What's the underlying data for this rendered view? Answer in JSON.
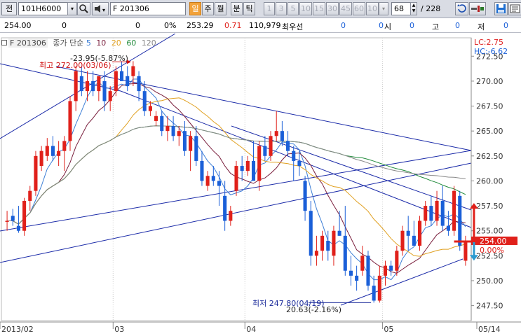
{
  "toolbar": {
    "code_prefix": "전",
    "code": "101H6000",
    "name": "F 201306",
    "periods": [
      "일",
      "주",
      "월",
      "분",
      "틱"
    ],
    "numbers": [
      "1",
      "3",
      "5",
      "10",
      "15",
      "30",
      "45",
      "60",
      "10"
    ],
    "count": "68",
    "total": "/ 228"
  },
  "quote": {
    "price": "254.00",
    "q1": "0",
    "q2": "0",
    "pct": "0%",
    "last": "253.29",
    "chg": "0.71",
    "volume": "110,979",
    "best_label": "최우선",
    "best_val": "0",
    "open_label": "시",
    "open_val": "0",
    "high_label": "고",
    "high_val": "0",
    "low_label": "저",
    "low_val": "0"
  },
  "legend": {
    "name": "F 201306",
    "prefix": "종가 단순",
    "ma": [
      "5",
      "10",
      "20",
      "60",
      "120"
    ]
  },
  "colors": {
    "up": "#e0201a",
    "down": "#1a5fd8",
    "ma5": "#3d7fd6",
    "ma10": "#7a1f3d",
    "ma20": "#e0a020",
    "ma60": "#1f8a3a",
    "ma120": "#888888",
    "trend": "#1a2aa8"
  },
  "annotations": {
    "high_label": "최고 272.00(03/06)",
    "high_pct": "-23.95(-5.87%)",
    "low_label": "최저 247.80(04/19)",
    "low_pct": "20.63(-2.16%)",
    "lc": "LC:2.75",
    "hc": "HC:-6.62",
    "current_price": "254.00",
    "current_pct": "0.00%"
  },
  "chart_data": {
    "type": "candlestick",
    "y_axis": [
      "272.50",
      "270.00",
      "267.50",
      "265.00",
      "262.50",
      "260.00",
      "257.50",
      "255.00",
      "252.50",
      "250.00",
      "247.50"
    ],
    "x_axis": [
      "2013/02",
      "03",
      "04",
      "05",
      "05/14"
    ],
    "ylim": [
      246.0,
      273.5
    ],
    "candles": [
      [
        256.0,
        257.0,
        255.0,
        256.0
      ],
      [
        256.5,
        257.2,
        255.5,
        256.0
      ],
      [
        255.5,
        257.5,
        254.8,
        255.0
      ],
      [
        255.0,
        258.3,
        254.5,
        258.0
      ],
      [
        258.0,
        259.5,
        257.0,
        259.0
      ],
      [
        259.0,
        263.0,
        258.5,
        262.5
      ],
      [
        261.5,
        263.5,
        261.0,
        263.0
      ],
      [
        262.5,
        264.3,
        262.0,
        263.5
      ],
      [
        263.5,
        264.5,
        262.0,
        262.5
      ],
      [
        262.5,
        264.0,
        261.5,
        263.0
      ],
      [
        263.0,
        264.5,
        261.0,
        264.0
      ],
      [
        264.0,
        268.5,
        263.0,
        268.0
      ],
      [
        268.0,
        271.5,
        267.0,
        271.0
      ],
      [
        270.5,
        271.5,
        268.5,
        269.0
      ],
      [
        269.0,
        271.0,
        268.0,
        270.0
      ],
      [
        270.0,
        271.0,
        268.5,
        269.0
      ],
      [
        269.0,
        270.5,
        268.0,
        270.5
      ],
      [
        270.0,
        271.0,
        267.0,
        268.0
      ],
      [
        268.0,
        269.5,
        267.0,
        269.0
      ],
      [
        269.0,
        271.5,
        268.5,
        271.0
      ],
      [
        271.0,
        272.0,
        270.0,
        270.0
      ],
      [
        270.5,
        271.5,
        269.0,
        269.5
      ],
      [
        270.5,
        272.0,
        269.5,
        271.5
      ],
      [
        270.5,
        271.0,
        268.0,
        269.0
      ],
      [
        269.0,
        270.0,
        266.5,
        267.0
      ],
      [
        267.0,
        268.0,
        266.5,
        267.5
      ],
      [
        266.0,
        267.0,
        265.5,
        266.5
      ],
      [
        266.5,
        267.0,
        264.5,
        265.0
      ],
      [
        265.0,
        266.5,
        264.0,
        265.5
      ],
      [
        265.5,
        266.5,
        264.0,
        264.5
      ],
      [
        264.5,
        265.5,
        263.5,
        265.0
      ],
      [
        265.0,
        266.0,
        262.5,
        263.0
      ],
      [
        263.0,
        265.0,
        261.0,
        264.5
      ],
      [
        264.5,
        265.5,
        261.5,
        262.0
      ],
      [
        262.0,
        263.0,
        259.5,
        260.0
      ],
      [
        259.5,
        261.0,
        259.0,
        260.5
      ],
      [
        260.5,
        261.5,
        259.5,
        260.0
      ],
      [
        260.0,
        261.0,
        257.5,
        259.5
      ],
      [
        258.5,
        260.0,
        255.0,
        256.0
      ],
      [
        256.0,
        257.5,
        255.5,
        257.0
      ],
      [
        259.0,
        262.0,
        258.5,
        261.5
      ],
      [
        261.5,
        262.5,
        260.0,
        261.0
      ],
      [
        261.0,
        262.5,
        260.5,
        262.0
      ],
      [
        262.0,
        264.0,
        260.5,
        260.0
      ],
      [
        260.0,
        264.0,
        259.0,
        263.5
      ],
      [
        263.5,
        264.5,
        262.0,
        262.5
      ],
      [
        262.5,
        265.0,
        262.0,
        264.5
      ],
      [
        264.5,
        267.0,
        264.0,
        265.0
      ],
      [
        265.0,
        266.0,
        263.5,
        264.0
      ],
      [
        264.0,
        265.0,
        262.5,
        263.0
      ],
      [
        263.0,
        263.5,
        260.0,
        262.0
      ],
      [
        262.0,
        263.0,
        260.5,
        261.5
      ],
      [
        260.0,
        260.5,
        256.0,
        257.0
      ],
      [
        257.0,
        258.0,
        251.5,
        252.5
      ],
      [
        252.5,
        254.5,
        251.5,
        253.0
      ],
      [
        253.0,
        255.0,
        252.0,
        254.5
      ],
      [
        254.0,
        255.0,
        252.0,
        253.0
      ],
      [
        252.5,
        255.5,
        251.5,
        255.0
      ],
      [
        255.0,
        257.0,
        254.5,
        254.5
      ],
      [
        254.5,
        257.5,
        250.5,
        251.0
      ],
      [
        251.0,
        252.5,
        249.5,
        250.5
      ],
      [
        250.5,
        251.5,
        249.0,
        250.0
      ],
      [
        251.0,
        253.5,
        250.5,
        252.5
      ],
      [
        252.5,
        253.0,
        249.0,
        249.5
      ],
      [
        249.5,
        250.5,
        247.8,
        248.0
      ],
      [
        248.0,
        251.5,
        247.8,
        250.5
      ],
      [
        250.5,
        252.0,
        249.5,
        251.5
      ],
      [
        251.5,
        252.0,
        250.5,
        251.0
      ],
      [
        251.0,
        253.5,
        250.5,
        253.0
      ],
      [
        253.0,
        255.5,
        252.5,
        255.0
      ],
      [
        255.0,
        256.5,
        253.0,
        254.5
      ],
      [
        254.5,
        256.0,
        253.5,
        253.5
      ],
      [
        253.5,
        256.5,
        253.0,
        256.0
      ],
      [
        256.0,
        258.0,
        255.5,
        257.5
      ],
      [
        257.5,
        258.5,
        255.5,
        256.0
      ],
      [
        256.0,
        259.0,
        255.5,
        258.0
      ],
      [
        258.0,
        259.5,
        255.0,
        255.5
      ],
      [
        255.5,
        257.0,
        254.5,
        255.0
      ],
      [
        255.0,
        259.5,
        254.5,
        259.0
      ],
      [
        258.5,
        259.0,
        253.0,
        253.5
      ],
      [
        252.0,
        254.5,
        251.5,
        254.0
      ]
    ]
  }
}
